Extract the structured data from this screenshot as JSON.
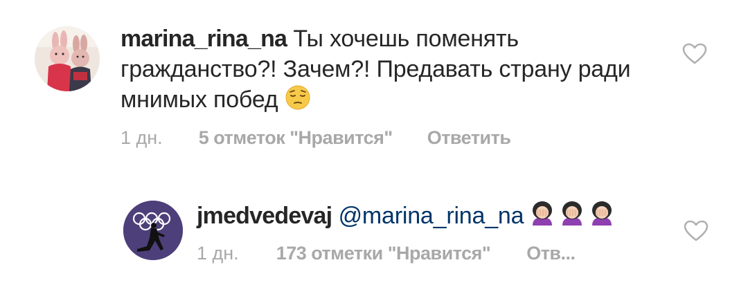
{
  "comments": [
    {
      "username": "marina_rina_na",
      "text": "Ты хочешь поменять гражданство?! Зачем?! Предавать страну ради мнимых побед",
      "emoji": "pensive-face-icon",
      "time": "1 дн.",
      "likes": "5 отметок \"Нравится\"",
      "reply": "Ответить",
      "avatar_icon": "bunny-dolls-avatar"
    },
    {
      "username": "jmedvedevaj",
      "mention": "@marina_rina_na",
      "emoji": "face-palm-icon",
      "emoji_count": 3,
      "time": "1 дн.",
      "likes": "173 отметки \"Нравится\"",
      "reply": "Отв...",
      "avatar_icon": "olympic-rings-skater-avatar"
    }
  ],
  "icons": {
    "like": "heart-outline-icon"
  },
  "colors": {
    "text": "#262626",
    "muted": "#a8a8a8",
    "mention": "#003569",
    "heart_stroke": "#b0b0b0",
    "avatar2_bg": "#4d3f7a"
  }
}
